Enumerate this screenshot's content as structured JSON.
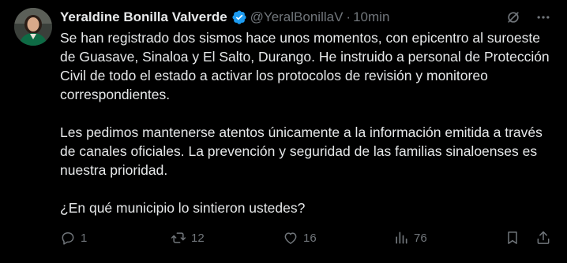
{
  "author": {
    "name": "Yeraldine Bonilla Valverde",
    "handle": "@YeralBonillaV",
    "separator": "·",
    "time": "10min",
    "verified_color": "#1d9bf0"
  },
  "paragraphs": [
    "Se han registrado dos sismos hace unos momentos, con epicentro al suroeste de Guasave, Sinaloa y El Salto, Durango. He instruido a personal de Protección Civil de todo el estado a activar los protocolos de revisión y monitoreo correspondientes.",
    "Les pedimos mantenerse atentos únicamente a la información emitida a través de canales oficiales. La prevención y seguridad de las familias sinaloenses es nuestra prioridad.",
    "¿En qué municipio lo sintieron ustedes?"
  ],
  "stats": {
    "replies": "1",
    "reposts": "12",
    "likes": "16",
    "views": "76"
  },
  "icons": {
    "top": [
      "grok-icon",
      "more-icon"
    ],
    "actions": [
      "reply-icon",
      "repost-icon",
      "like-icon",
      "views-icon",
      "bookmark-icon",
      "share-icon"
    ]
  },
  "colors": {
    "background": "#000000",
    "text": "#e7e9ea",
    "secondary": "#71767b",
    "accent": "#1d9bf0"
  }
}
